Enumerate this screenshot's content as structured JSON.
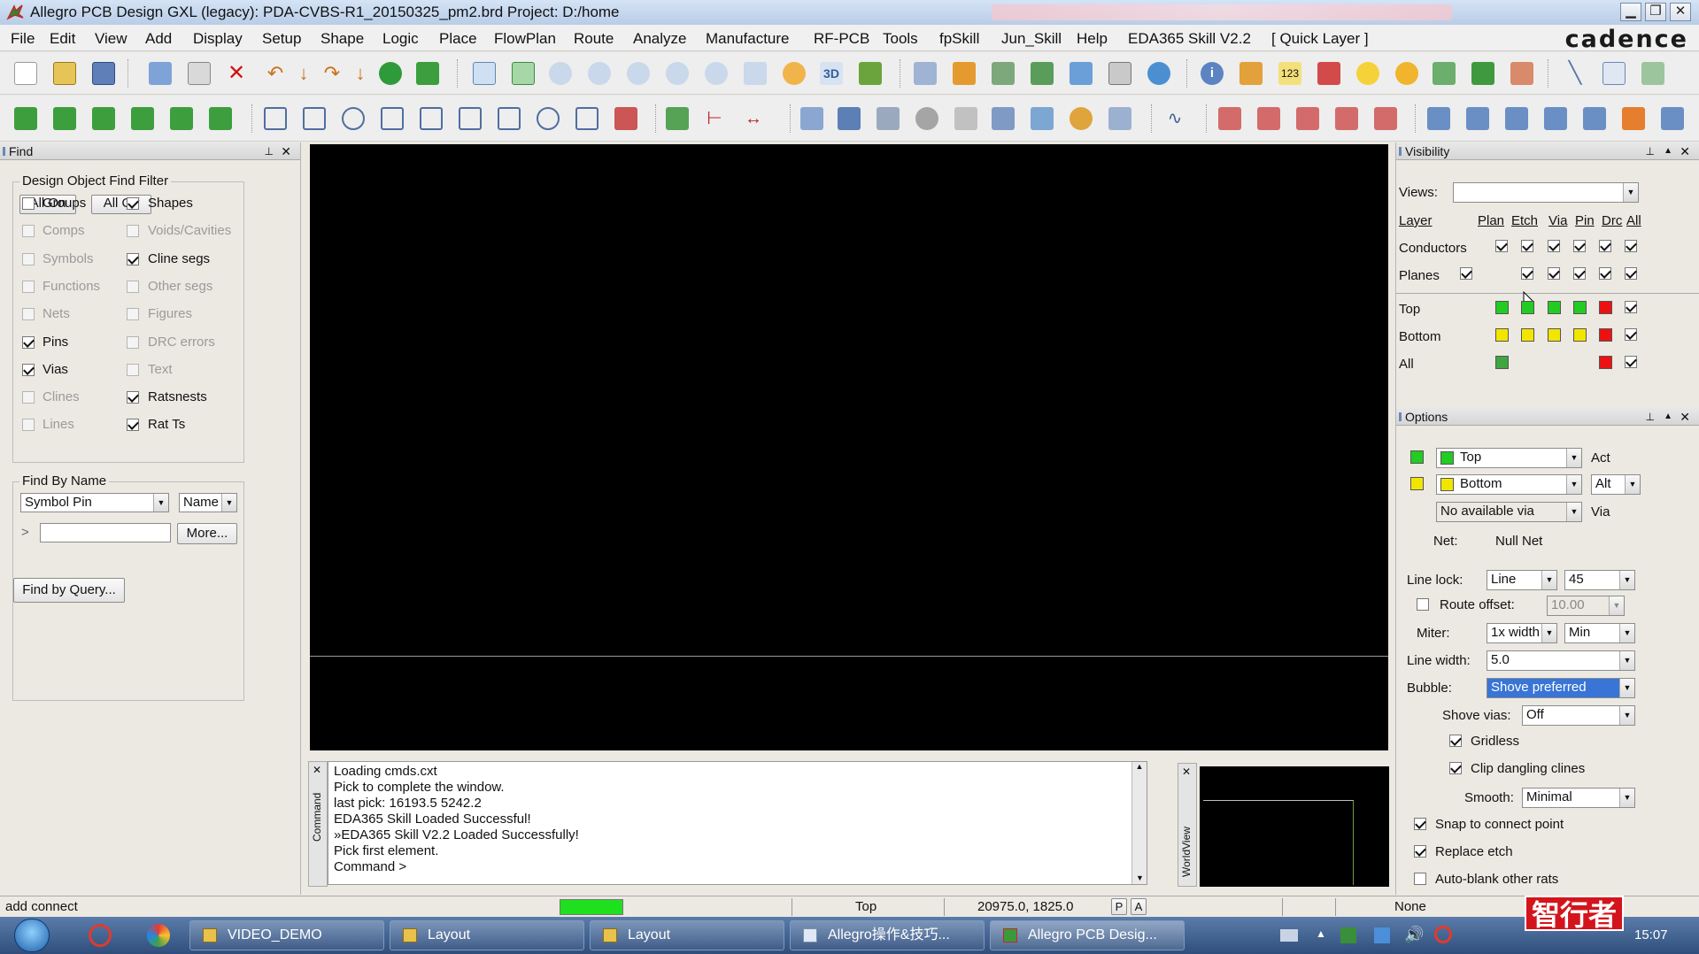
{
  "window": {
    "title": "Allegro PCB Design GXL (legacy): PDA-CVBS-R1_20150325_pm2.brd  Project: D:/home",
    "min": "▁",
    "max": "❐",
    "close": "✕"
  },
  "menu": [
    "File",
    "Edit",
    "View",
    "Add",
    "Display",
    "Setup",
    "Shape",
    "Logic",
    "Place",
    "FlowPlan",
    "Route",
    "Analyze",
    "Manufacture",
    "RF-PCB",
    "Tools",
    "fpSkill",
    "Jun_Skill",
    "Help",
    "EDA365 Skill V2.2",
    "[ Quick Layer ]"
  ],
  "brand": "cadence",
  "find": {
    "header": "Find",
    "filter_title": "Design Object Find Filter",
    "all_on": "All On",
    "all_off": "All Off",
    "left": [
      {
        "label": "Groups",
        "checked": false,
        "enabled": true
      },
      {
        "label": "Comps",
        "checked": false,
        "enabled": false
      },
      {
        "label": "Symbols",
        "checked": false,
        "enabled": false
      },
      {
        "label": "Functions",
        "checked": false,
        "enabled": false
      },
      {
        "label": "Nets",
        "checked": false,
        "enabled": false
      },
      {
        "label": "Pins",
        "checked": true,
        "enabled": true
      },
      {
        "label": "Vias",
        "checked": true,
        "enabled": true
      },
      {
        "label": "Clines",
        "checked": false,
        "enabled": false
      },
      {
        "label": "Lines",
        "checked": false,
        "enabled": false
      }
    ],
    "right": [
      {
        "label": "Shapes",
        "checked": true,
        "enabled": true
      },
      {
        "label": "Voids/Cavities",
        "checked": false,
        "enabled": false
      },
      {
        "label": "Cline segs",
        "checked": true,
        "enabled": true
      },
      {
        "label": "Other segs",
        "checked": false,
        "enabled": false
      },
      {
        "label": "Figures",
        "checked": false,
        "enabled": false
      },
      {
        "label": "DRC errors",
        "checked": false,
        "enabled": false
      },
      {
        "label": "Text",
        "checked": false,
        "enabled": false
      },
      {
        "label": "Ratsnests",
        "checked": true,
        "enabled": true
      },
      {
        "label": "Rat Ts",
        "checked": true,
        "enabled": true
      }
    ],
    "by_name_title": "Find By Name",
    "type_value": "Symbol Pin",
    "name_value": "Name",
    "prompt": ">",
    "more": "More...",
    "query": "Find by Query..."
  },
  "visibility": {
    "header": "Visibility",
    "views_label": "Views:",
    "views_value": "",
    "cols": [
      "Layer",
      "Plan",
      "Etch",
      "Via",
      "Pin",
      "Drc",
      "All"
    ],
    "rows": [
      "Conductors",
      "Planes",
      "Top",
      "Bottom",
      "All"
    ]
  },
  "options": {
    "header": "Options",
    "active_layer": "Top",
    "alt_layer": "Bottom",
    "via": "No available via",
    "act": "Act",
    "alt": "Alt",
    "via_label": "Via",
    "net_label": "Net:",
    "net_value": "Null Net",
    "line_lock_label": "Line lock:",
    "line_lock": "Line",
    "angle": "45",
    "route_offset_label": "Route offset:",
    "route_offset": "10.00",
    "miter_label": "Miter:",
    "miter": "1x width",
    "miter_min": "Min",
    "line_width_label": "Line width:",
    "line_width": "5.0",
    "bubble_label": "Bubble:",
    "bubble": "Shove preferred",
    "shove_vias_label": "Shove vias:",
    "shove_vias": "Off",
    "gridless": "Gridless",
    "clip": "Clip dangling clines",
    "smooth_label": "Smooth:",
    "smooth": "Minimal",
    "snap": "Snap to connect point",
    "replace": "Replace etch",
    "autoblank": "Auto-blank other rats",
    "colors": {
      "top": "#22cc22",
      "bottom": "#f2e600",
      "drc": "#ee1111"
    }
  },
  "command": {
    "side_label": "Command",
    "lines": [
      "Loading cmds.cxt",
      "Pick to complete the window.",
      "last pick:  16193.5 5242.2",
      "EDA365 Skill Loaded Successful!",
      "»EDA365 Skill V2.2 Loaded Successfully!",
      "Pick first element.",
      "Command >"
    ]
  },
  "worldview": {
    "side_label": "WorldView"
  },
  "status": {
    "mode": "add connect",
    "layer": "Top",
    "coords": "20975.0, 1825.0",
    "p": "P",
    "a": "A",
    "net": "None"
  },
  "taskbar": {
    "items": [
      "VIDEO_DEMO",
      "Layout",
      "Layout",
      "Allegro操作&技巧...",
      "Allegro PCB Desig..."
    ],
    "time": "15:07",
    "watermark": "智行者"
  }
}
